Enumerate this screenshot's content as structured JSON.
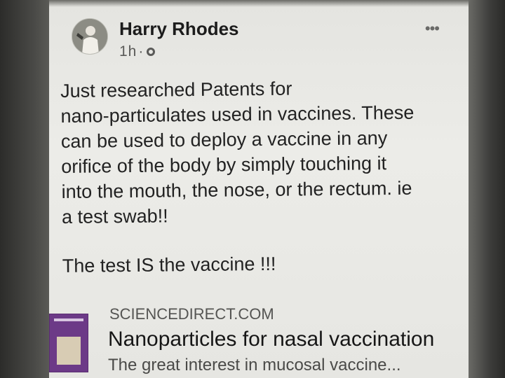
{
  "post": {
    "author": "Harry Rhodes",
    "time": "1h",
    "more_label": "•••",
    "text_lines": [
      "Just researched Patents for",
      "nano-particulates used in vaccines. These",
      "can be used to deploy a vaccine in any",
      "orifice of the body by simply touching it",
      "into the mouth, the nose, or the rectum. ie",
      "a test swab!!"
    ],
    "text_line2": "The test IS the vaccine !!!"
  },
  "link_preview": {
    "source": "SCIENCEDIRECT.COM",
    "title": "Nanoparticles for nasal vaccination",
    "description": "The great interest in mucosal vaccine..."
  },
  "colors": {
    "screen_bg": "#e8e8e4",
    "thumbnail": "#6c3a87"
  },
  "icons": [
    "globe-icon",
    "more-options-icon"
  ]
}
